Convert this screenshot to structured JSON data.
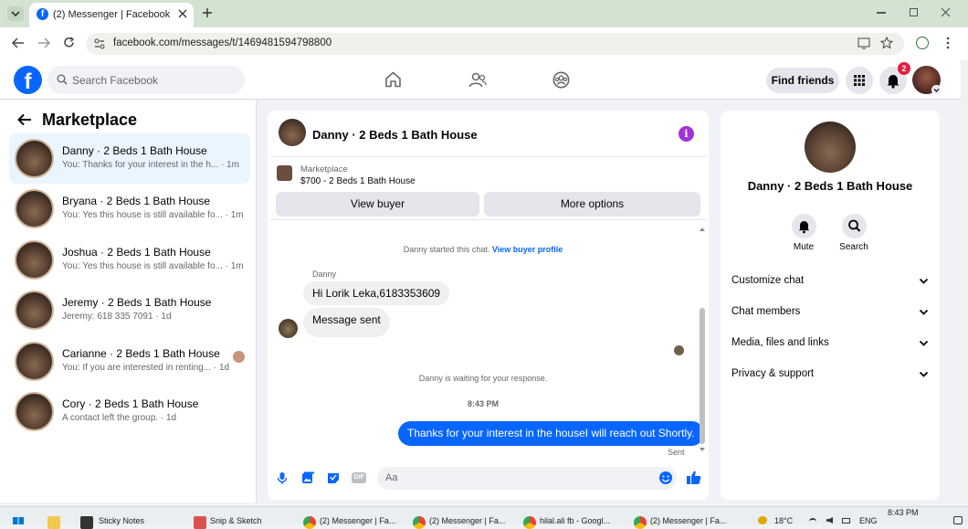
{
  "browser": {
    "tab_title": "(2) Messenger | Facebook",
    "url": "facebook.com/messages/t/1469481594798800"
  },
  "fb_header": {
    "search_placeholder": "Search Facebook",
    "find_friends": "Find friends",
    "notification_count": "2"
  },
  "sidebar": {
    "title": "Marketplace",
    "conversations": [
      {
        "name": "Danny · 2 Beds 1 Bath House",
        "preview": "You: Thanks for your interest in the h... · 1m"
      },
      {
        "name": "Bryana · 2 Beds 1 Bath House",
        "preview": "You: Yes this house is still available fo... · 1m"
      },
      {
        "name": "Joshua · 2 Beds 1 Bath House",
        "preview": "You: Yes this house is still available fo... · 1m"
      },
      {
        "name": "Jeremy · 2 Beds 1 Bath House",
        "preview": "Jeremy: 618 335 7091 · 1d"
      },
      {
        "name": "Carianne · 2 Beds 1 Bath House",
        "preview": "You: If you are interested in renting... · 1d"
      },
      {
        "name": "Cory · 2 Beds 1 Bath House",
        "preview": "A contact left the group. · 1d"
      }
    ]
  },
  "chat": {
    "title": "Danny · 2 Beds 1 Bath House",
    "marketplace_label": "Marketplace",
    "listing": "$700 - 2 Beds 1 Bath House",
    "view_buyer": "View buyer",
    "more_options": "More options",
    "started_text": "Danny started this chat.",
    "view_buyer_profile": "View buyer profile",
    "sender_name": "Danny",
    "msg1": "Hi Lorik Leka,6183353609",
    "msg2": "Message sent",
    "waiting": "Danny is waiting for your response.",
    "time": "8:43 PM",
    "outgoing": "Thanks for your interest in the houseI will reach out Shortly.",
    "sent": "Sent",
    "composer_placeholder": "Aa"
  },
  "right_panel": {
    "title": "Danny · 2 Beds 1 Bath House",
    "mute": "Mute",
    "search": "Search",
    "options": [
      "Customize chat",
      "Chat members",
      "Media, files and links",
      "Privacy & support"
    ]
  },
  "taskbar": {
    "items": [
      "Sticky Notes",
      "Snip & Sketch",
      "(2) Messenger | Fa...",
      "(2) Messenger | Fa...",
      "hilal.ali fb - Googl...",
      "(2) Messenger | Fa..."
    ],
    "time": "8:43 PM",
    "lang": "ENG",
    "temp": "18°C"
  }
}
